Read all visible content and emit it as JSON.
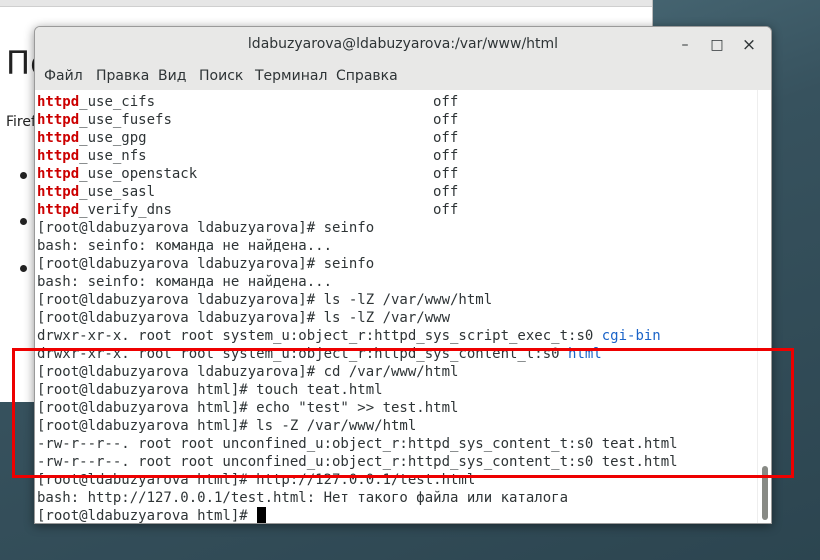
{
  "browser": {
    "heading": "По",
    "text": "Firef"
  },
  "window": {
    "title": "ldabuzyarova@ldabuzyarova:/var/www/html",
    "minimize": "–",
    "maximize": "□",
    "close": "×"
  },
  "menu": [
    "Файл",
    "Правка",
    "Вид",
    "Поиск",
    "Терминал",
    "Справка"
  ],
  "booleans": [
    {
      "prefix": "httpd",
      "rest": "_use_cifs",
      "value": "off"
    },
    {
      "prefix": "httpd",
      "rest": "_use_fusefs",
      "value": "off"
    },
    {
      "prefix": "httpd",
      "rest": "_use_gpg",
      "value": "off"
    },
    {
      "prefix": "httpd",
      "rest": "_use_nfs",
      "value": "off"
    },
    {
      "prefix": "httpd",
      "rest": "_use_openstack",
      "value": "off"
    },
    {
      "prefix": "httpd",
      "rest": "_use_sasl",
      "value": "off"
    },
    {
      "prefix": "httpd",
      "rest": "_verify_dns",
      "value": "off"
    }
  ],
  "lines": [
    "[root@ldabuzyarova ldabuzyarova]# seinfo",
    "bash: seinfo: команда не найдена...",
    "[root@ldabuzyarova ldabuzyarova]# seinfo",
    "bash: seinfo: команда не найдена...",
    "[root@ldabuzyarova ldabuzyarova]# ls -lZ /var/www/html",
    "[root@ldabuzyarova ldabuzyarova]# ls -lZ /var/www"
  ],
  "listing": [
    {
      "text": "drwxr-xr-x. root root system_u:object_r:httpd_sys_script_exec_t:s0 ",
      "name": "cgi-bin"
    },
    {
      "text": "drwxr-xr-x. root root system_u:object_r:httpd_sys_content_t:s0 ",
      "name": "html"
    }
  ],
  "lines2": [
    "[root@ldabuzyarova ldabuzyarova]# cd /var/www/html",
    "[root@ldabuzyarova html]# touch teat.html",
    "[root@ldabuzyarova html]# echo \"test\" >> test.html",
    "[root@ldabuzyarova html]# ls -Z /var/www/html",
    "-rw-r--r--. root root unconfined_u:object_r:httpd_sys_content_t:s0 teat.html",
    "-rw-r--r--. root root unconfined_u:object_r:httpd_sys_content_t:s0 test.html",
    "[root@ldabuzyarova html]# http://127.0.0.1/test.html",
    "bash: http://127.0.0.1/test.html: Нет такого файла или каталога"
  ],
  "prompt": "[root@ldabuzyarova html]# ",
  "colors": {
    "keyword_red": "#cc0000",
    "link_blue": "#1a63c8",
    "highlight_red": "#ee0000"
  }
}
